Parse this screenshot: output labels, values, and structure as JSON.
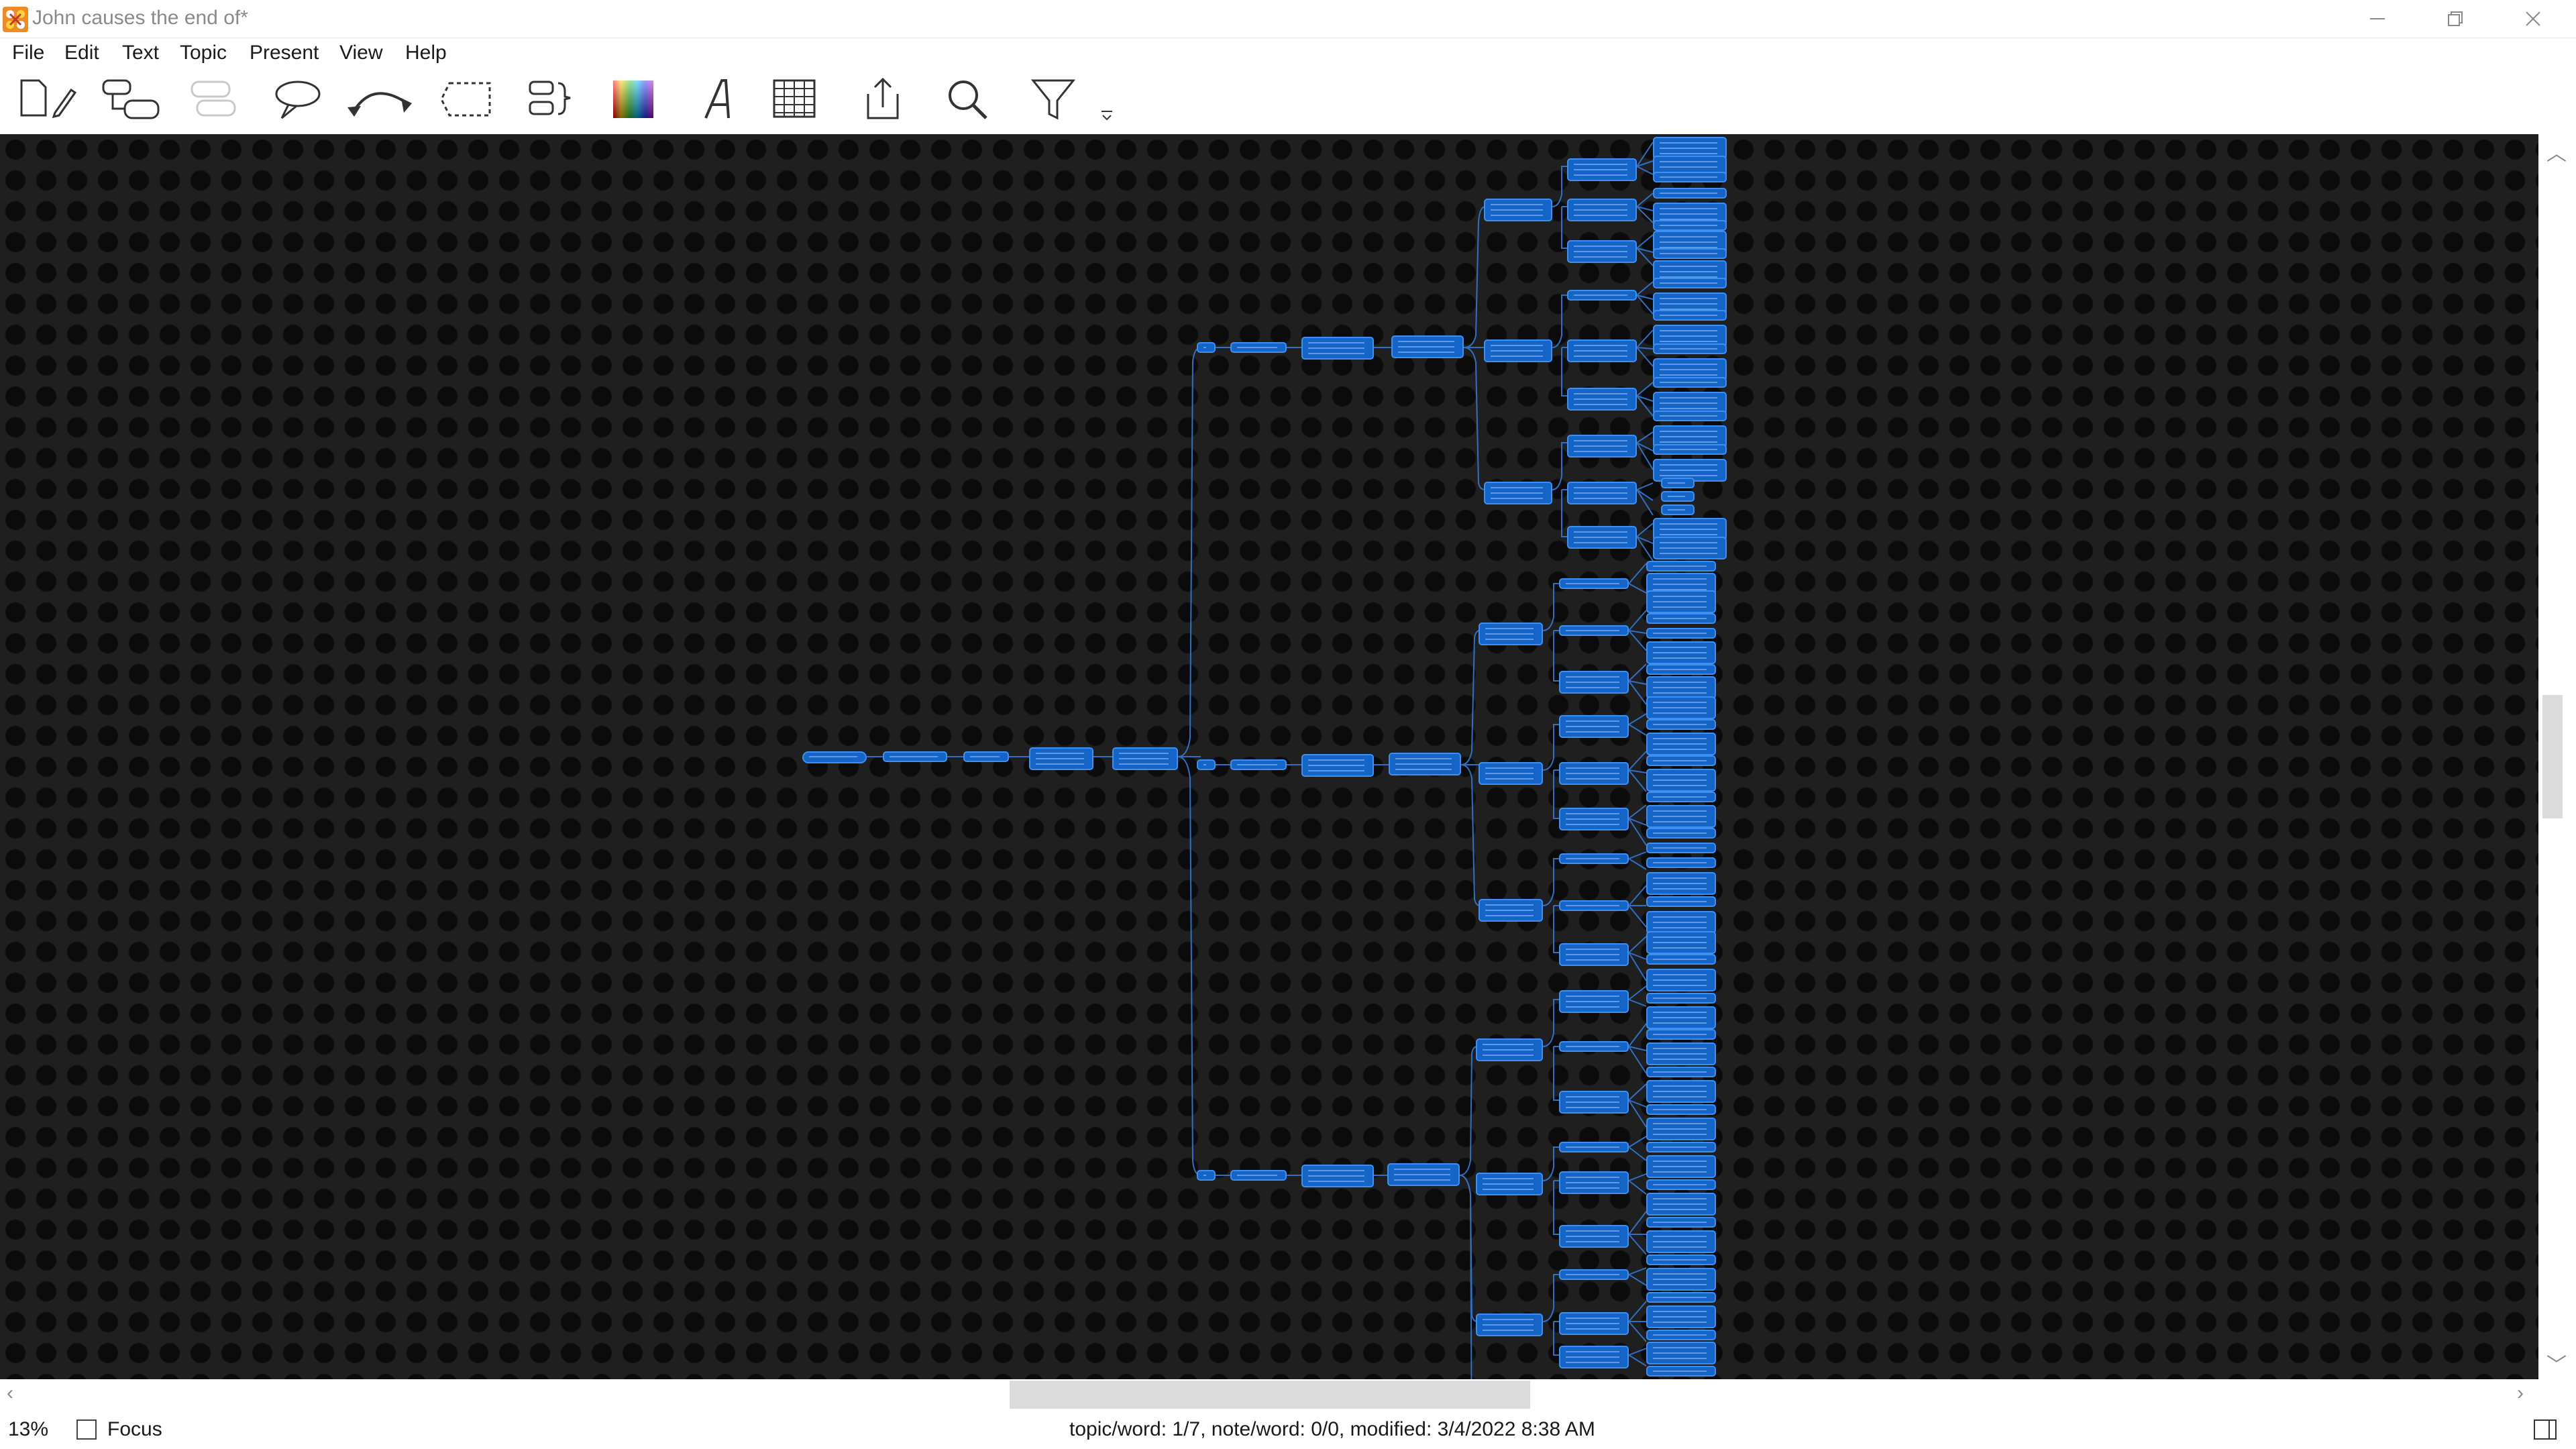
{
  "window": {
    "title": "John causes the end of*",
    "controls": [
      "minimize",
      "maximize",
      "close"
    ]
  },
  "menu": {
    "items": [
      "File",
      "Edit",
      "Text",
      "Topic",
      "Present",
      "View",
      "Help"
    ]
  },
  "toolbar": {
    "tools": [
      {
        "name": "new-document-icon"
      },
      {
        "name": "add-subtopic-icon"
      },
      {
        "name": "add-sibling-icon",
        "disabled": true
      },
      {
        "name": "callout-icon"
      },
      {
        "name": "relationship-icon"
      },
      {
        "name": "boundary-icon"
      },
      {
        "name": "summary-icon"
      },
      {
        "name": "color-palette-icon"
      },
      {
        "name": "text-format-icon"
      },
      {
        "name": "table-icon"
      },
      {
        "name": "export-icon"
      },
      {
        "name": "search-icon"
      },
      {
        "name": "filter-icon"
      },
      {
        "name": "more-icon"
      }
    ]
  },
  "canvas": {
    "background": "#1f1f1f",
    "node_color": "#1565c9",
    "line_color": "#2f6fc4"
  },
  "status": {
    "zoom": "13%",
    "focus_label": "Focus",
    "focus_checked": false,
    "info": "topic/word: 1/7, note/word: 0/0, modified: 3/4/2022 8:38 AM"
  }
}
